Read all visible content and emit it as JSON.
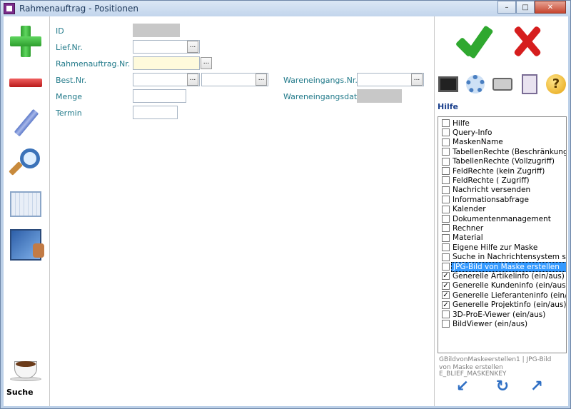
{
  "window": {
    "title": "Rahmenauftrag - Positionen",
    "buttons": {
      "minimize": "–",
      "maximize": "□",
      "close": "✕"
    }
  },
  "left_toolbar": {
    "suche_label": "Suche"
  },
  "form": {
    "id_label": "ID",
    "lief_nr_label": "Lief.Nr.",
    "rahmenauftrag_nr_label": "Rahmenauftrag.Nr.",
    "best_nr_label": "Best.Nr.",
    "menge_label": "Menge",
    "termin_label": "Termin",
    "wareneingangs_nr_label": "Wareneingangs.Nr.",
    "wareneingangsdatum_label": "Wareneingangsdatum",
    "dots": "..."
  },
  "right_panel": {
    "hilfe_title": "Hilfe",
    "help_items": [
      {
        "label": "Hilfe",
        "checked": false,
        "selected": false
      },
      {
        "label": "Query-Info",
        "checked": false,
        "selected": false
      },
      {
        "label": "MaskenName",
        "checked": false,
        "selected": false
      },
      {
        "label": "TabellenRechte (Beschränkung)",
        "checked": false,
        "selected": false
      },
      {
        "label": "TabellenRechte (Vollzugriff)",
        "checked": false,
        "selected": false
      },
      {
        "label": "FeldRechte (kein Zugriff)",
        "checked": false,
        "selected": false
      },
      {
        "label": "FeldRechte ( Zugriff)",
        "checked": false,
        "selected": false
      },
      {
        "label": "Nachricht versenden",
        "checked": false,
        "selected": false
      },
      {
        "label": "Informationsabfrage",
        "checked": false,
        "selected": false
      },
      {
        "label": "Kalender",
        "checked": false,
        "selected": false
      },
      {
        "label": "Dokumentenmanagement",
        "checked": false,
        "selected": false
      },
      {
        "label": "Rechner",
        "checked": false,
        "selected": false
      },
      {
        "label": "Material",
        "checked": false,
        "selected": false
      },
      {
        "label": "Eigene Hilfe zur Maske",
        "checked": false,
        "selected": false
      },
      {
        "label": "Suche in Nachrichtensystem speicl",
        "checked": false,
        "selected": false
      },
      {
        "label": "JPG-Bild von Maske erstellen",
        "checked": false,
        "selected": true
      },
      {
        "label": "Generelle Artikelinfo (ein/aus)",
        "checked": true,
        "selected": false
      },
      {
        "label": "Generelle Kundeninfo (ein/aus)",
        "checked": true,
        "selected": false
      },
      {
        "label": "Generelle Lieferanteninfo (ein/aus)",
        "checked": true,
        "selected": false
      },
      {
        "label": "Generelle Projektinfo (ein/aus)",
        "checked": true,
        "selected": false
      },
      {
        "label": "3D-ProE-Viewer (ein/aus)",
        "checked": false,
        "selected": false
      },
      {
        "label": "BildViewer (ein/aus)",
        "checked": false,
        "selected": false
      }
    ],
    "footer_line1": "GBildvonMaskeerstellen1 | JPG-Bild von Maske erstellen",
    "footer_line2": "E_BLIEF_MASKENKEY",
    "check_mark": "✓",
    "nav_arrows": {
      "down_left": "↙",
      "refresh": "↻",
      "up_right": "↗"
    },
    "icons": {
      "confirm": "check-icon",
      "cancel": "x-icon",
      "monitor": "monitor-icon",
      "gear": "gear-icon",
      "printer": "printer-icon",
      "docsearch": "document-search-icon",
      "help": "question-icon",
      "help_glyph": "?"
    }
  }
}
